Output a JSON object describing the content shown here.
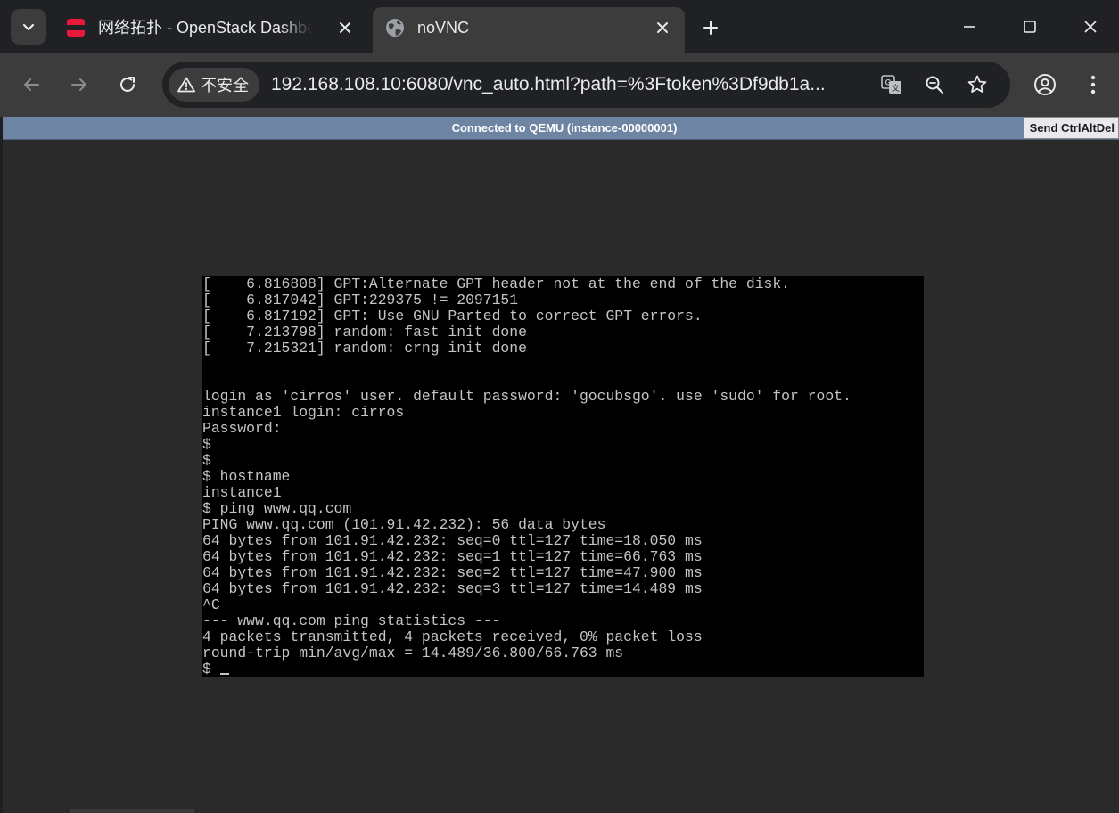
{
  "browser": {
    "tabs": [
      {
        "title": "网络拓扑 - OpenStack Dashboard",
        "favicon": "openstack-logo-icon",
        "active": false
      },
      {
        "title": "noVNC",
        "favicon": "globe-icon",
        "active": true
      }
    ],
    "omnibox": {
      "security_label": "不安全",
      "url": "192.168.108.10:6080/vnc_auto.html?path=%3Ftoken%3Df9db1a..."
    },
    "icons": {
      "tab_search": "chevron-down-icon",
      "new_tab": "plus-icon",
      "minimize": "minimize-icon",
      "maximize": "maximize-icon",
      "close": "close-icon",
      "back": "arrow-back-icon",
      "forward": "arrow-forward-icon",
      "reload": "reload-icon",
      "translate": "translate-icon",
      "zoom": "zoom-icon",
      "bookmark": "star-icon",
      "profile": "account-icon",
      "menu": "more-vert-icon"
    },
    "colors": {
      "tab_strip": "#202124",
      "toolbar": "#3c3c3c",
      "openstack_red": "#e8193c"
    }
  },
  "vnc": {
    "status_text": "Connected to QEMU (instance-00000001)",
    "send_cad_label": "Send CtrlAltDel",
    "status_bar_color": "#6e84a3",
    "console_lines": [
      "[    6.816808] GPT:Alternate GPT header not at the end of the disk.",
      "[    6.817042] GPT:229375 != 2097151",
      "[    6.817192] GPT: Use GNU Parted to correct GPT errors.",
      "[    7.213798] random: fast init done",
      "[    7.215321] random: crng init done",
      "",
      "",
      "login as 'cirros' user. default password: 'gocubsgo'. use 'sudo' for root.",
      "instance1 login: cirros",
      "Password:",
      "$",
      "$",
      "$ hostname",
      "instance1",
      "$ ping www.qq.com",
      "PING www.qq.com (101.91.42.232): 56 data bytes",
      "64 bytes from 101.91.42.232: seq=0 ttl=127 time=18.050 ms",
      "64 bytes from 101.91.42.232: seq=1 ttl=127 time=66.763 ms",
      "64 bytes from 101.91.42.232: seq=2 ttl=127 time=47.900 ms",
      "64 bytes from 101.91.42.232: seq=3 ttl=127 time=14.489 ms",
      "^C",
      "--- www.qq.com ping statistics ---",
      "4 packets transmitted, 4 packets received, 0% packet loss",
      "round-trip min/avg/max = 14.489/36.800/66.763 ms"
    ],
    "prompt": "$ "
  }
}
